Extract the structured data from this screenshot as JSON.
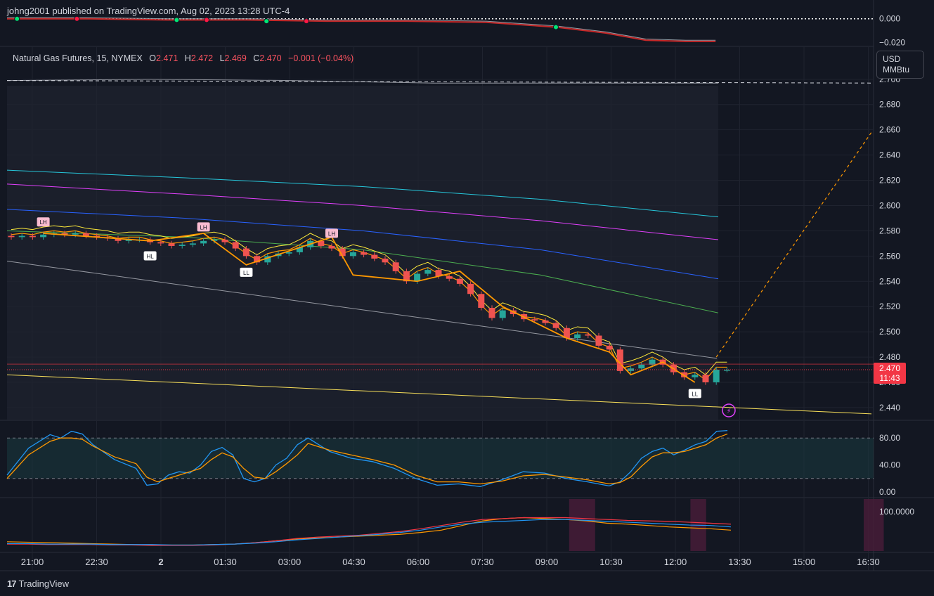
{
  "header": {
    "published": "johng2001 published on TradingView.com, Aug 02, 2023 13:28 UTC-4"
  },
  "legend": {
    "symbol": "Natural Gas Futures, 15, NYMEX",
    "o_label": "O",
    "o_value": "2.471",
    "h_label": "H",
    "h_value": "2.472",
    "l_label": "L",
    "l_value": "2.469",
    "c_label": "C",
    "c_value": "2.470",
    "change": "−0.001 (−0.04%)"
  },
  "units": {
    "currency": "USD",
    "unit": "MMBtu"
  },
  "last_price": {
    "price": "2.470",
    "countdown": "11:43"
  },
  "footer": {
    "brand": "TradingView"
  },
  "colors": {
    "background": "#131722",
    "up": "#26a69a",
    "down": "#ef5350",
    "grid": "#2a2e39",
    "text": "#d1d4dc"
  },
  "chart_data": [
    {
      "type": "line",
      "panel": "top-oscillator",
      "y_ticks": [
        "0.000",
        "−0.020"
      ],
      "ylim": [
        -0.022,
        0.001
      ],
      "series": [
        {
          "x": [
            0,
            8,
            16,
            24,
            32,
            40,
            48,
            55,
            60,
            64,
            68,
            71
          ],
          "values": [
            0.0,
            0.0,
            -0.001,
            -0.001,
            -0.002,
            -0.002,
            -0.003,
            -0.007,
            -0.012,
            -0.018,
            -0.019,
            -0.019
          ]
        }
      ],
      "markers": [
        {
          "x": 1,
          "color": "green"
        },
        {
          "x": 7,
          "color": "red"
        },
        {
          "x": 17,
          "color": "green"
        },
        {
          "x": 20,
          "color": "red"
        },
        {
          "x": 26,
          "color": "green"
        },
        {
          "x": 30,
          "color": "red"
        },
        {
          "x": 55,
          "color": "green"
        }
      ]
    },
    {
      "type": "candlestick",
      "panel": "price",
      "y_ticks": [
        "2.700",
        "2.680",
        "2.660",
        "2.640",
        "2.620",
        "2.600",
        "2.580",
        "2.560",
        "2.540",
        "2.520",
        "2.500",
        "2.480",
        "2.460",
        "2.440"
      ],
      "ylim": [
        2.4305,
        2.7255
      ],
      "x_ticks": [
        "21:00",
        "22:30",
        "2",
        "01:30",
        "03:00",
        "04:30",
        "06:00",
        "07:30",
        "09:00",
        "10:30",
        "12:00",
        "13:30",
        "15:00",
        "16:30"
      ],
      "close": [
        2.575,
        2.576,
        2.575,
        2.577,
        2.578,
        2.577,
        2.578,
        2.576,
        2.575,
        2.574,
        2.572,
        2.573,
        2.573,
        2.571,
        2.57,
        2.568,
        2.569,
        2.57,
        2.572,
        2.573,
        2.571,
        2.566,
        2.56,
        2.555,
        2.56,
        2.562,
        2.563,
        2.567,
        2.572,
        2.568,
        2.566,
        2.56,
        2.563,
        2.561,
        2.558,
        2.555,
        2.548,
        2.54,
        2.546,
        2.549,
        2.544,
        2.542,
        2.538,
        2.53,
        2.519,
        2.511,
        2.517,
        2.514,
        2.51,
        2.509,
        2.507,
        2.503,
        2.495,
        2.498,
        2.497,
        2.489,
        2.486,
        2.469,
        2.471,
        2.474,
        2.478,
        2.474,
        2.468,
        2.464,
        2.466,
        2.46,
        2.47,
        2.47
      ],
      "levels": [
        {
          "name": "",
          "values": [
            2.699,
            2.7,
            2.699,
            2.697,
            2.697,
            2.697
          ]
        },
        {
          "name": "",
          "values": [
            2.628,
            2.622,
            2.615,
            2.605,
            2.591
          ]
        },
        {
          "name": "",
          "values": [
            2.617,
            2.609,
            2.6,
            2.588,
            2.573
          ]
        },
        {
          "name": "",
          "values": [
            2.597,
            2.59,
            2.58,
            2.565,
            2.542
          ]
        },
        {
          "name": "",
          "values": [
            2.58,
            2.575,
            2.565,
            2.545,
            2.515
          ]
        }
      ],
      "swing_labels": [
        {
          "text": "LH",
          "x": 3,
          "y": 2.584,
          "kind": "high"
        },
        {
          "text": "HL",
          "x": 13,
          "y": 2.566,
          "kind": "low"
        },
        {
          "text": "LH",
          "x": 18,
          "y": 2.58,
          "kind": "high"
        },
        {
          "text": "LL",
          "x": 22,
          "y": 2.553,
          "kind": "low"
        },
        {
          "text": "LH",
          "x": 30,
          "y": 2.575,
          "kind": "high"
        },
        {
          "text": "LL",
          "x": 64,
          "y": 2.457,
          "kind": "low"
        }
      ],
      "projection": {
        "from": [
          66,
          2.48
        ],
        "to": [
          78,
          2.658
        ]
      },
      "last_price": 2.47
    },
    {
      "type": "line",
      "panel": "rsi",
      "y_ticks": [
        "80.00",
        "40.00",
        "0.00"
      ],
      "ylim": [
        0,
        100
      ],
      "band": [
        20,
        80
      ],
      "x": [
        0,
        2,
        4,
        5,
        6,
        7,
        8,
        10,
        12,
        13,
        14,
        15,
        16,
        17,
        18,
        19,
        20,
        21,
        22,
        23,
        24,
        25,
        26,
        27,
        28,
        30,
        32,
        34,
        36,
        38,
        40,
        42,
        44,
        46,
        48,
        50,
        52,
        54,
        55,
        56,
        57,
        58,
        59,
        60,
        61,
        62,
        63,
        64,
        65,
        66,
        67
      ],
      "series": [
        {
          "name": "",
          "values": [
            25,
            65,
            85,
            80,
            90,
            86,
            70,
            48,
            35,
            10,
            12,
            25,
            30,
            28,
            40,
            60,
            66,
            55,
            20,
            15,
            20,
            40,
            50,
            70,
            80,
            60,
            50,
            45,
            35,
            20,
            10,
            12,
            8,
            18,
            30,
            28,
            20,
            15,
            12,
            9,
            15,
            30,
            50,
            60,
            65,
            55,
            62,
            70,
            75,
            90,
            91
          ]
        },
        {
          "name": "",
          "values": [
            20,
            55,
            75,
            80,
            80,
            78,
            68,
            52,
            42,
            22,
            15,
            20,
            25,
            30,
            35,
            48,
            58,
            52,
            35,
            22,
            20,
            30,
            42,
            55,
            72,
            62,
            55,
            48,
            40,
            25,
            15,
            15,
            12,
            16,
            24,
            26,
            22,
            18,
            15,
            12,
            14,
            22,
            38,
            52,
            58,
            58,
            60,
            65,
            70,
            80,
            86
          ]
        }
      ]
    },
    {
      "type": "line",
      "panel": "bottom-indicator",
      "y_ticks": [
        "100.0000"
      ],
      "series": [
        {
          "name": "",
          "values": [
            20,
            19,
            18,
            17,
            16,
            15,
            14,
            13,
            13,
            13,
            14,
            15,
            18,
            22,
            26,
            28,
            30,
            32,
            34,
            36,
            40,
            45,
            55,
            65,
            70,
            72,
            70,
            68,
            65,
            60,
            58,
            55,
            52,
            50,
            48,
            45
          ]
        },
        {
          "name": "",
          "values": [
            15,
            15,
            14,
            14,
            14,
            13,
            13,
            12,
            12,
            12,
            13,
            15,
            18,
            22,
            27,
            30,
            32,
            34,
            38,
            42,
            48,
            55,
            62,
            68,
            70,
            72,
            72,
            72,
            70,
            68,
            66,
            65,
            64,
            62,
            60,
            58
          ]
        },
        {
          "name": "",
          "values": [
            16,
            16,
            15,
            15,
            15,
            14,
            14,
            14,
            13,
            13,
            14,
            15,
            17,
            20,
            24,
            27,
            30,
            33,
            36,
            40,
            45,
            52,
            58,
            62,
            64,
            66,
            68,
            68,
            66,
            64,
            62,
            60,
            58,
            56,
            55,
            52
          ]
        }
      ],
      "highlight_regions": [
        [
          0.6,
          0.63
        ],
        [
          0.74,
          0.75
        ],
        [
          0.94,
          0.955
        ]
      ]
    }
  ]
}
